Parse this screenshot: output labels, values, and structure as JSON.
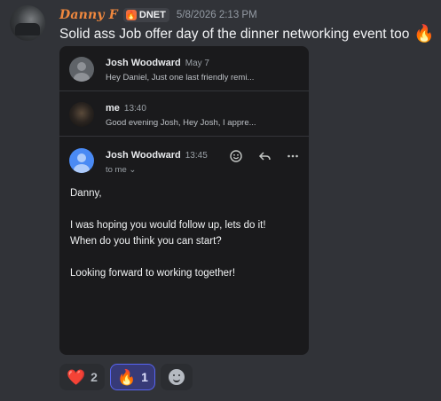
{
  "message": {
    "author": "Danny F",
    "tag": "DNET",
    "tag_icon": "flame-badge-icon",
    "timestamp": "5/8/2026 2:13 PM",
    "text": "Solid ass Job offer day of the dinner networking event too",
    "trailing_emoji": "🔥"
  },
  "email": {
    "threads": [
      {
        "sender": "Josh Woodward",
        "time": "May 7",
        "snippet": "Hey Daniel, Just one last friendly remi..."
      },
      {
        "sender": "me",
        "time": "13:40",
        "snippet": "Good evening Josh, Hey Josh, I appre..."
      }
    ],
    "open": {
      "sender": "Josh Woodward",
      "time": "13:45",
      "to": "to me",
      "to_chevron": "⌄",
      "body": [
        "Danny,",
        "",
        "I was hoping you would follow up, lets do it!",
        "When do you think you can start?",
        "",
        "Looking forward to working together!"
      ]
    }
  },
  "reactions": [
    {
      "emoji": "❤️",
      "count": "2",
      "active": false
    },
    {
      "emoji": "🔥",
      "count": "1",
      "active": true
    }
  ],
  "colors": {
    "background": "#313338",
    "username": "#f0883e",
    "active_reaction": "#5865f2"
  }
}
